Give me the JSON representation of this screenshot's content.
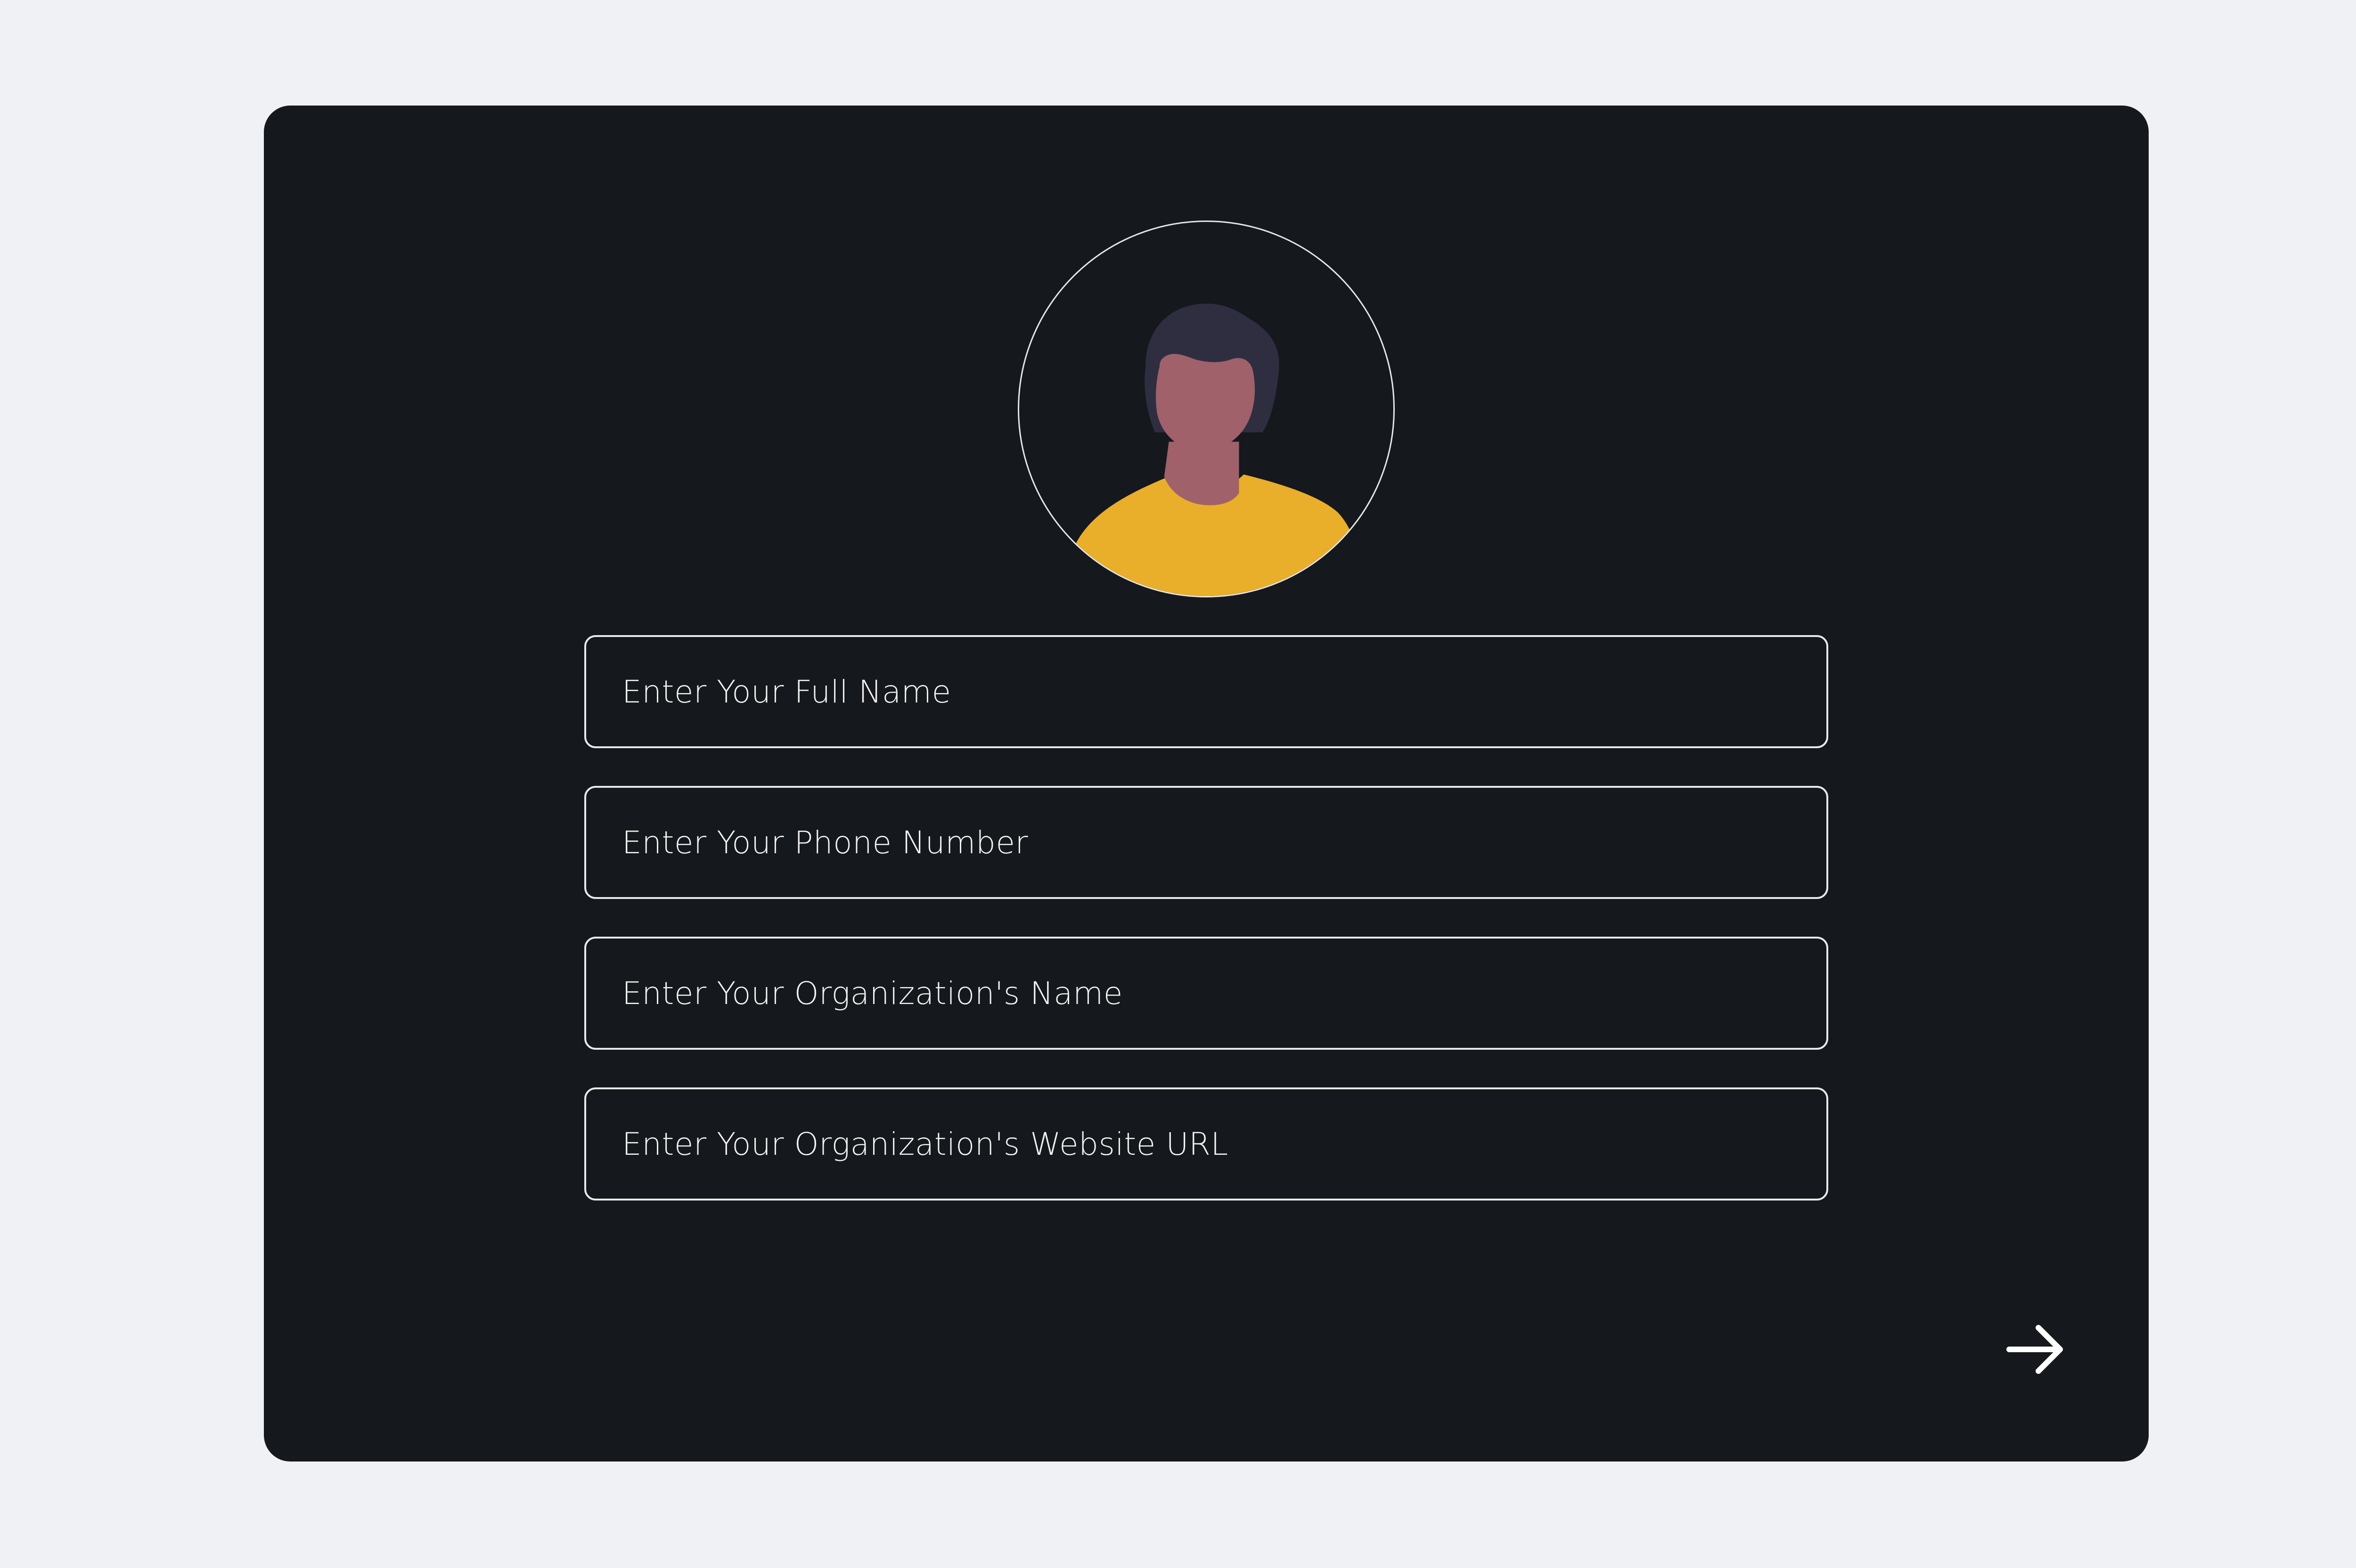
{
  "form": {
    "fields": [
      {
        "placeholder": "Enter Your Full Name"
      },
      {
        "placeholder": "Enter Your Phone Number"
      },
      {
        "placeholder": "Enter Your Organization's Name"
      },
      {
        "placeholder": "Enter Your Organization's Website URL"
      }
    ]
  },
  "avatar": {
    "icon": "user-avatar-illustration",
    "colors": {
      "hair": "#2f2e41",
      "skin": "#a0616a",
      "shirt": "#e9ae2a",
      "border": "#e6e6e6"
    }
  },
  "actions": {
    "next_icon": "arrow-right-icon"
  },
  "colors": {
    "page_background": "#f0f1f5",
    "card_background": "#15181c",
    "field_border": "#e9e9ea",
    "text": "#f2f2f2"
  }
}
